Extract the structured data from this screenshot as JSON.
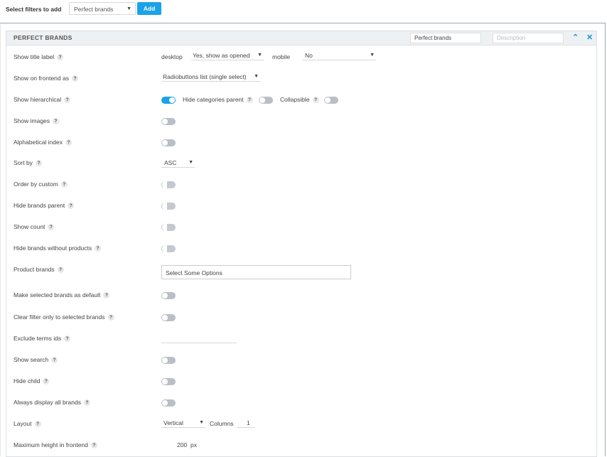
{
  "topbar": {
    "label": "Select filters to add",
    "select_value": "Perfect brands",
    "add_label": "Add"
  },
  "panel": {
    "title": "PERFECT BRANDS",
    "name_value": "Perfect brands",
    "description_placeholder": "Description"
  },
  "help_glyph": "?",
  "rows": {
    "show_title_label": "Show title label",
    "show_on_frontend_as": "Show on frontend as",
    "show_hierarchical": "Show hierarchical",
    "show_images": "Show images",
    "alphabetical_index": "Alphabetical index",
    "sort_by": "Sort by",
    "order_by_custom": "Order by custom",
    "hide_brands_parent": "Hide brands parent",
    "show_count": "Show count",
    "hide_brands_without_products": "Hide brands without products",
    "product_brands": "Product brands",
    "make_selected_default": "Make selected brands as default",
    "clear_filter_selected": "Clear filter only to selected brands",
    "exclude_terms_ids": "Exclude terms ids",
    "show_search": "Show search",
    "hide_child": "Hide child",
    "always_display_all": "Always display all brands",
    "layout": "Layout",
    "max_height": "Maximum height in frontend"
  },
  "controls": {
    "desktop_label": "desktop",
    "desktop_value": "Yes, show as opened",
    "mobile_label": "mobile",
    "mobile_value": "No",
    "frontend_as_value": "Radiobuttons list (single select)",
    "hierarchical_on": true,
    "hide_categories_parent_label": "Hide categories parent",
    "collapsible_label": "Collapsible",
    "sort_by_value": "ASC",
    "product_brands_placeholder": "Select Some Options",
    "layout_value": "Vertical",
    "columns_label": "Columns",
    "columns_value": "1",
    "max_height_value": "200",
    "max_height_unit": "px"
  },
  "colors": {
    "accent": "#1aa3e8",
    "toggle_off": "#b8bfc6",
    "panel_header_bg": "#eef1f4"
  }
}
